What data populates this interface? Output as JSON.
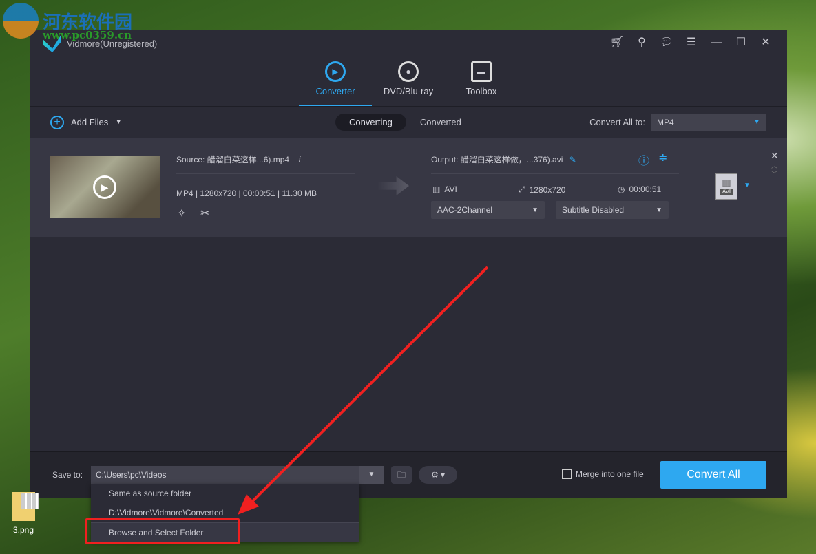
{
  "watermark": {
    "name": "河东软件园",
    "url": "www.pc0359.cn"
  },
  "window": {
    "title": "Vidmore(Unregistered)"
  },
  "nav": [
    {
      "label": "Converter"
    },
    {
      "label": "DVD/Blu-ray"
    },
    {
      "label": "Toolbox"
    }
  ],
  "toolbar": {
    "add_files": "Add Files",
    "tabs": [
      "Converting",
      "Converted"
    ],
    "convert_all_to_label": "Convert All to:",
    "convert_all_to_value": "MP4"
  },
  "item": {
    "source": "Source: 醋溜白菜这样...6).mp4",
    "meta": [
      "MP4",
      "1280x720",
      "00:00:51",
      "11.30 MB"
    ],
    "output": "Output: 醋溜白菜这样做，...376).avi",
    "out_format": "AVI",
    "out_resolution": "1280x720",
    "out_duration": "00:00:51",
    "audio": "AAC-2Channel",
    "subtitle": "Subtitle Disabled",
    "format_badge": "AVI"
  },
  "bottom": {
    "save_to_label": "Save to:",
    "save_path": "C:\\Users\\pc\\Videos",
    "merge_label": "Merge into one file",
    "convert_all": "Convert All"
  },
  "menu": [
    "Same as source folder",
    "D:\\Vidmore\\Vidmore\\Converted",
    "Browse and Select Folder"
  ],
  "desktop": {
    "icon_label": "3.png"
  },
  "colors": {
    "accent": "#2ea8f0",
    "annotation": "#f02020"
  }
}
